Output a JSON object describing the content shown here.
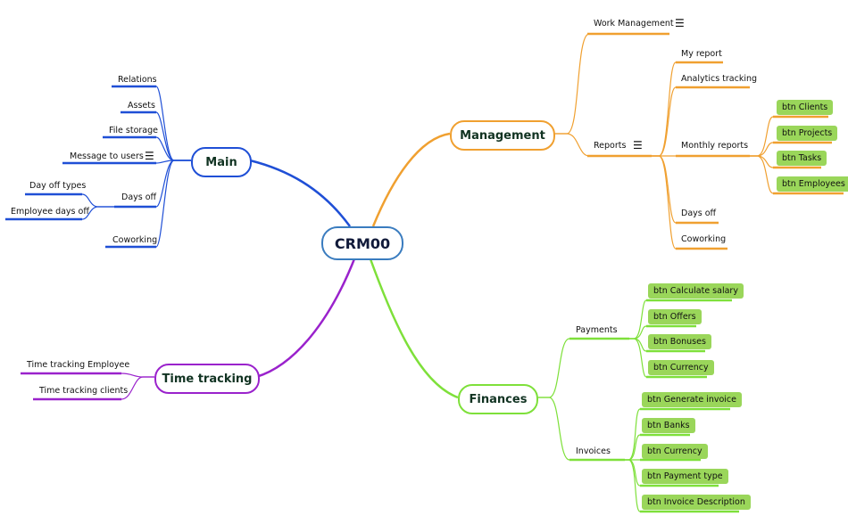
{
  "root": {
    "label": "CRM00",
    "color": "#3a7cbf"
  },
  "branches": {
    "main": {
      "label": "Main",
      "color": "#1f4fd6",
      "children": [
        {
          "label": "Relations"
        },
        {
          "label": "Assets"
        },
        {
          "label": "File storage"
        },
        {
          "label": "Message to users",
          "icon": "notes-icon"
        },
        {
          "label": "Days off",
          "children": [
            {
              "label": "Day off types"
            },
            {
              "label": "Employee days off"
            }
          ]
        },
        {
          "label": "Coworking"
        }
      ]
    },
    "management": {
      "label": "Management",
      "color": "#f0a030",
      "children": [
        {
          "label": "Work Management",
          "icon": "notes-icon"
        },
        {
          "label": "Reports",
          "icon": "notes-icon",
          "children": [
            {
              "label": "My report"
            },
            {
              "label": "Analytics tracking"
            },
            {
              "label": "Monthly reports",
              "children": [
                {
                  "label": "btn Clients"
                },
                {
                  "label": "btn Projects"
                },
                {
                  "label": "btn Tasks"
                },
                {
                  "label": "btn Employees"
                }
              ]
            },
            {
              "label": "Days off"
            },
            {
              "label": "Coworking"
            }
          ]
        }
      ]
    },
    "time_tracking": {
      "label": "Time tracking",
      "color": "#9a22cc",
      "children": [
        {
          "label": "Time tracking Employee"
        },
        {
          "label": "Time tracking clients"
        }
      ]
    },
    "finances": {
      "label": "Finances",
      "color": "#7ee03a",
      "children": [
        {
          "label": "Payments",
          "children": [
            {
              "label": "btn Calculate salary"
            },
            {
              "label": "btn Offers"
            },
            {
              "label": "btn Bonuses"
            },
            {
              "label": "btn Currency"
            }
          ]
        },
        {
          "label": "Invoices",
          "children": [
            {
              "label": "btn Generate invoice"
            },
            {
              "label": "btn Banks"
            },
            {
              "label": "btn Currency"
            },
            {
              "label": "btn Payment type"
            },
            {
              "label": "btn Invoice Description"
            }
          ]
        }
      ]
    }
  },
  "colors": {
    "button_fill": "#9ad65a"
  }
}
